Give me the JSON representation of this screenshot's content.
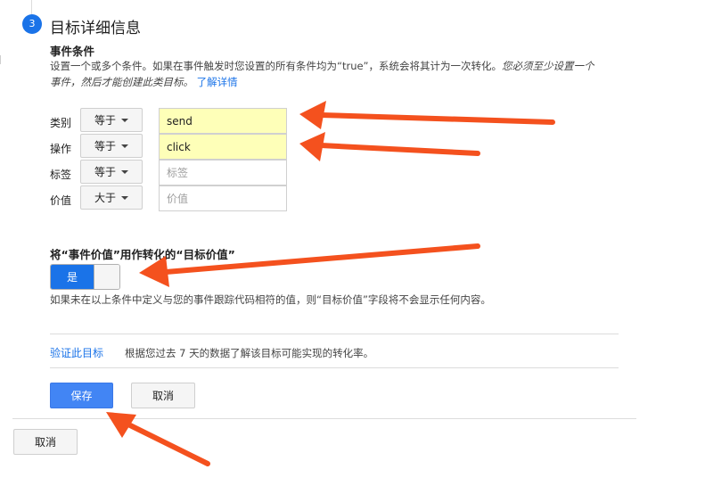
{
  "step": {
    "number": "3",
    "title": "目标详细信息"
  },
  "conditions": {
    "heading": "事件条件",
    "description_line1": "设置一个或多个条件。如果在事件触发时您设置的所有条件均为“true”，系统会将其计为一次转化。",
    "description_italic_a": "您必须至少设置一个",
    "description_italic_b": "事件，然后才能创建此类目标。",
    "learn_more": "了解详情",
    "rows": [
      {
        "label": "类别",
        "operator": "等于",
        "value": "send",
        "placeholder": "",
        "filled": true
      },
      {
        "label": "操作",
        "operator": "等于",
        "value": "click",
        "placeholder": "",
        "filled": true
      },
      {
        "label": "标签",
        "operator": "等于",
        "value": "",
        "placeholder": "标签",
        "filled": false
      },
      {
        "label": "价值",
        "operator": "大于",
        "value": "",
        "placeholder": "价值",
        "filled": false
      }
    ]
  },
  "goal_value": {
    "heading": "将“事件价值”用作转化的“目标价值”",
    "toggle_label": "是",
    "toggle_state": "on",
    "note": "如果未在以上条件中定义与您的事件跟踪代码相符的值，则“目标价值”字段将不会显示任何内容。"
  },
  "verify": {
    "link": "验证此目标",
    "note": "根据您过去 7 天的数据了解该目标可能实现的转化率。"
  },
  "actions": {
    "save": "保存",
    "cancel_inner": "取消",
    "cancel_outer": "取消"
  },
  "colors": {
    "accent": "#1a73e8",
    "primary_button": "#4285f4",
    "highlight": "#feffb8",
    "annotation_arrow": "#f4511e"
  }
}
